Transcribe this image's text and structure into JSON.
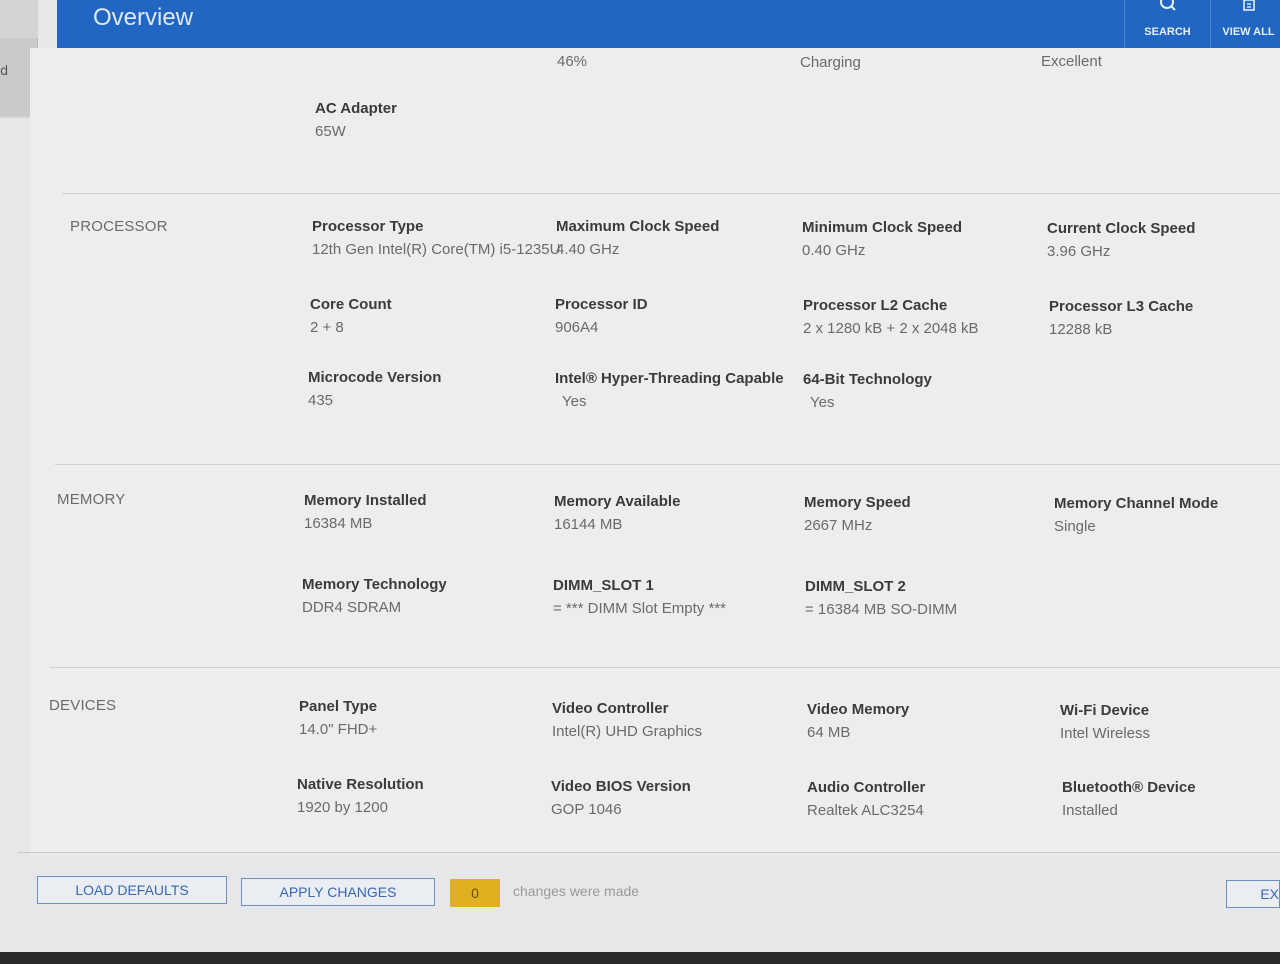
{
  "header": {
    "title": "Overview",
    "search_label": "SEARCH",
    "view_all_label": "VIEW ALL",
    "search_icon": "search-icon",
    "view_all_icon": "view-all-icon"
  },
  "sidebar": {
    "tab_label": "d"
  },
  "battery": {
    "charge": "46%",
    "state": "Charging",
    "health": "Excellent",
    "ac_adapter_label": "AC Adapter",
    "ac_adapter_value": "65W"
  },
  "processor": {
    "section": "PROCESSOR",
    "type_label": "Processor Type",
    "type_value": "12th Gen Intel(R) Core(TM) i5-1235U",
    "max_clock_label": "Maximum Clock Speed",
    "max_clock_value": "4.40 GHz",
    "min_clock_label": "Minimum Clock Speed",
    "min_clock_value": "0.40 GHz",
    "cur_clock_label": "Current Clock Speed",
    "cur_clock_value": "3.96 GHz",
    "core_count_label": "Core Count",
    "core_count_value": "2 + 8",
    "id_label": "Processor ID",
    "id_value": "906A4",
    "l2_label": "Processor L2 Cache",
    "l2_value": "2 x 1280  kB + 2 x 2048  kB",
    "l3_label": "Processor L3 Cache",
    "l3_value": "12288 kB",
    "microcode_label": "Microcode Version",
    "microcode_value": "435",
    "ht_label": "Intel® Hyper-Threading Capable",
    "ht_value": "Yes",
    "x64_label": "64-Bit Technology",
    "x64_value": "Yes"
  },
  "memory": {
    "section": "MEMORY",
    "installed_label": "Memory Installed",
    "installed_value": "16384 MB",
    "available_label": "Memory Available",
    "available_value": "16144 MB",
    "speed_label": "Memory Speed",
    "speed_value": "2667 MHz",
    "channel_label": "Memory Channel Mode",
    "channel_value": "Single",
    "tech_label": "Memory Technology",
    "tech_value": "DDR4 SDRAM",
    "slot1_label": "DIMM_SLOT 1",
    "slot1_value": "= *** DIMM Slot Empty ***",
    "slot2_label": "DIMM_SLOT 2",
    "slot2_value": "= 16384 MB SO-DIMM"
  },
  "devices": {
    "section": "DEVICES",
    "panel_label": "Panel Type",
    "panel_value": "14.0\" FHD+",
    "video_label": "Video Controller",
    "video_value": "Intel(R) UHD Graphics",
    "vmem_label": "Video Memory",
    "vmem_value": "64 MB",
    "wifi_label": "Wi-Fi Device",
    "wifi_value": "Intel Wireless",
    "native_label": "Native Resolution",
    "native_value": "1920 by 1200",
    "vbios_label": "Video BIOS Version",
    "vbios_value": "GOP 1046",
    "audio_label": "Audio Controller",
    "audio_value": "Realtek ALC3254",
    "bt_label": "Bluetooth® Device",
    "bt_value": "Installed"
  },
  "footer": {
    "load_defaults": "LOAD DEFAULTS",
    "apply_changes": "APPLY CHANGES",
    "change_count": "0",
    "changes_text": "changes were made",
    "exit_label": "EX"
  },
  "colors": {
    "header_blue": "#2166c2",
    "badge_yellow": "#e1b021",
    "button_text": "#3668b4"
  }
}
